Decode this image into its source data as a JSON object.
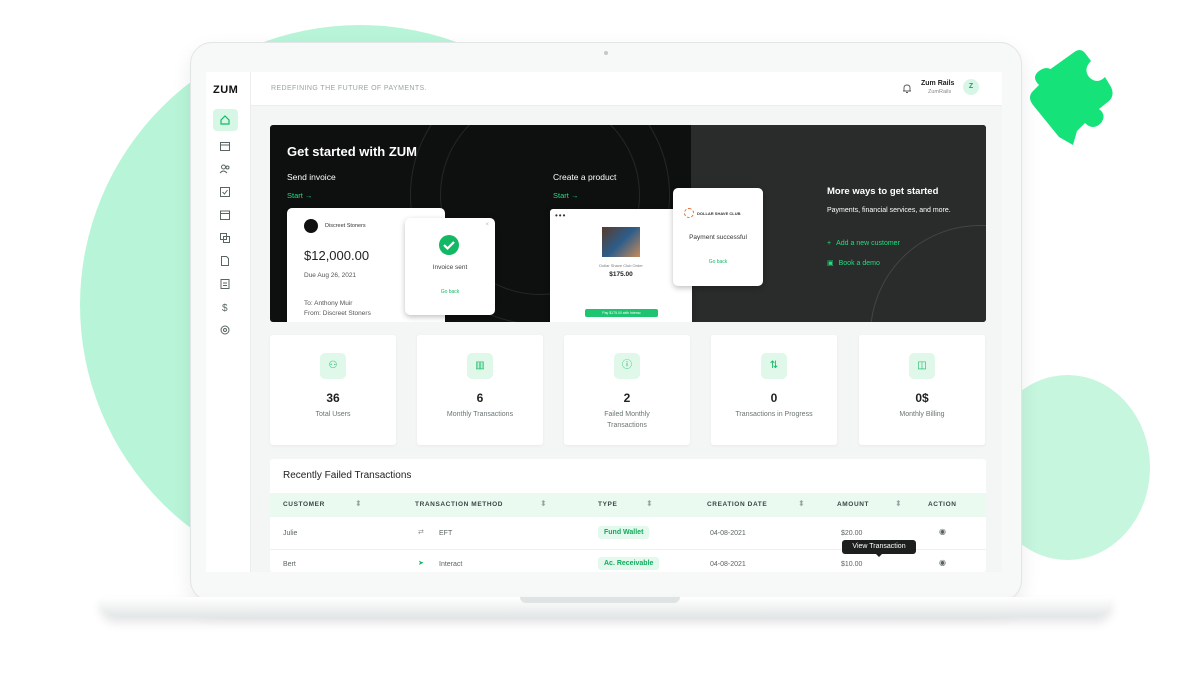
{
  "brand": {
    "logo": "ZUM",
    "tagline": "REDEFINING THE FUTURE OF PAYMENTS.",
    "accent": "#1ee07e"
  },
  "user": {
    "name": "Zum Rails",
    "subtitle": "ZumRails",
    "initial": "Z"
  },
  "sidebar": {
    "icons": [
      "home-icon",
      "calendar-icon",
      "users-icon",
      "checklist-icon",
      "schedule-icon",
      "copy-icon",
      "document-icon",
      "report-icon",
      "dollar-icon",
      "settings-icon"
    ]
  },
  "hero": {
    "title": "Get started with ZUM",
    "send_invoice": {
      "label": "Send invoice",
      "start": "Start →",
      "company": "Discreet Stoners",
      "amount": "$12,000.00",
      "due": "Due Aug 26, 2021",
      "to": "To: Anthony Muir",
      "from": "From: Discreet Stoners",
      "sent_label": "Invoice sent",
      "go_back": "Go back"
    },
    "create_product": {
      "label": "Create a product",
      "start": "Start →",
      "product_name": "Dollar Shave Club Order",
      "price": "$175.00",
      "button": "Pay $175.00 with Interac",
      "merchant": "DOLLAR SHAVE CLUB",
      "success": "Payment successful",
      "go_back": "Go back"
    },
    "more": {
      "title": "More ways to get started",
      "description": "Payments, financial services, and more.",
      "add_customer": "Add a new customer",
      "book_demo": "Book a demo"
    }
  },
  "stats": [
    {
      "value": "36",
      "label": "Total Users",
      "icon": "users-icon"
    },
    {
      "value": "6",
      "label": "Monthly Transactions",
      "icon": "chart-icon"
    },
    {
      "value": "2",
      "label": "Failed Monthly Transactions",
      "icon": "alert-icon"
    },
    {
      "value": "0",
      "label": "Transactions in Progress",
      "icon": "transfer-icon"
    },
    {
      "value": "0$",
      "label": "Monthly Billing",
      "icon": "wallet-icon"
    }
  ],
  "table": {
    "title": "Recently Failed Transactions",
    "columns": [
      "CUSTOMER",
      "TRANSACTION METHOD",
      "TYPE",
      "CREATION DATE",
      "AMOUNT",
      "ACTION"
    ],
    "rows": [
      {
        "customer": "Julie",
        "method": "EFT",
        "type": "Fund Wallet",
        "date": "04-08-2021",
        "amount": "$20.00"
      },
      {
        "customer": "Bert",
        "method": "Interact",
        "type": "Ac. Receivable",
        "date": "04-08-2021",
        "amount": "$10.00"
      }
    ],
    "tooltip": "View Transaction"
  }
}
